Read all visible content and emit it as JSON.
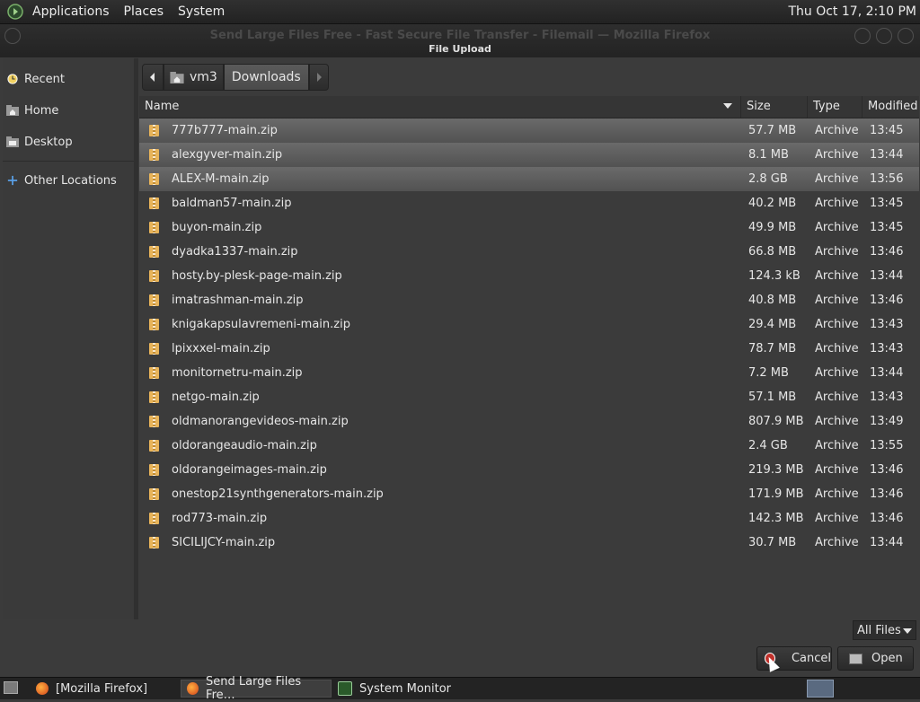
{
  "top_panel": {
    "menus": [
      "Applications",
      "Places",
      "System"
    ],
    "clock": "Thu Oct 17,  2:10 PM"
  },
  "window": {
    "bg_title": "Send Large Files Free - Fast Secure File Transfer - Filemail — Mozilla Firefox",
    "dialog_title": "File Upload"
  },
  "sidebar": {
    "items": [
      {
        "label": "Recent",
        "icon": "clock-icon"
      },
      {
        "label": "Home",
        "icon": "home-folder-icon"
      },
      {
        "label": "Desktop",
        "icon": "desktop-folder-icon"
      },
      {
        "label": "Other Locations",
        "icon": "plus-icon"
      }
    ]
  },
  "pathbar": {
    "crumbs": [
      "vm3",
      "Downloads"
    ]
  },
  "columns": {
    "name": "Name",
    "size": "Size",
    "type": "Type",
    "modified": "Modified"
  },
  "files": [
    {
      "name": "777b777-main.zip",
      "size": "57.7 MB",
      "type": "Archive",
      "modified": "13:45",
      "selected": true
    },
    {
      "name": "alexgyver-main.zip",
      "size": "8.1 MB",
      "type": "Archive",
      "modified": "13:44",
      "selected": true
    },
    {
      "name": "ALEX-M-main.zip",
      "size": "2.8 GB",
      "type": "Archive",
      "modified": "13:56",
      "selected": true
    },
    {
      "name": "baldman57-main.zip",
      "size": "40.2 MB",
      "type": "Archive",
      "modified": "13:45",
      "selected": false
    },
    {
      "name": "buyon-main.zip",
      "size": "49.9 MB",
      "type": "Archive",
      "modified": "13:45",
      "selected": false
    },
    {
      "name": "dyadka1337-main.zip",
      "size": "66.8 MB",
      "type": "Archive",
      "modified": "13:46",
      "selected": false
    },
    {
      "name": "hosty.by-plesk-page-main.zip",
      "size": "124.3 kB",
      "type": "Archive",
      "modified": "13:44",
      "selected": false
    },
    {
      "name": "imatrashman-main.zip",
      "size": "40.8 MB",
      "type": "Archive",
      "modified": "13:46",
      "selected": false
    },
    {
      "name": "knigakapsulavremeni-main.zip",
      "size": "29.4 MB",
      "type": "Archive",
      "modified": "13:43",
      "selected": false
    },
    {
      "name": "lpixxxel-main.zip",
      "size": "78.7 MB",
      "type": "Archive",
      "modified": "13:43",
      "selected": false
    },
    {
      "name": "monitornetru-main.zip",
      "size": "7.2 MB",
      "type": "Archive",
      "modified": "13:44",
      "selected": false
    },
    {
      "name": "netgo-main.zip",
      "size": "57.1 MB",
      "type": "Archive",
      "modified": "13:43",
      "selected": false
    },
    {
      "name": "oldmanorangevideos-main.zip",
      "size": "807.9 MB",
      "type": "Archive",
      "modified": "13:49",
      "selected": false
    },
    {
      "name": "oldorangeaudio-main.zip",
      "size": "2.4 GB",
      "type": "Archive",
      "modified": "13:55",
      "selected": false
    },
    {
      "name": "oldorangeimages-main.zip",
      "size": "219.3 MB",
      "type": "Archive",
      "modified": "13:46",
      "selected": false
    },
    {
      "name": "onestop21synthgenerators-main.zip",
      "size": "171.9 MB",
      "type": "Archive",
      "modified": "13:46",
      "selected": false
    },
    {
      "name": "rod773-main.zip",
      "size": "142.3 MB",
      "type": "Archive",
      "modified": "13:46",
      "selected": false
    },
    {
      "name": "SICILIJCY-main.zip",
      "size": "30.7 MB",
      "type": "Archive",
      "modified": "13:44",
      "selected": false
    }
  ],
  "filter": {
    "label": "All Files"
  },
  "buttons": {
    "cancel": "Cancel",
    "open": "Open"
  },
  "taskbar": {
    "tasks": [
      "[Mozilla Firefox]",
      "Send Large Files Fre…",
      "System Monitor"
    ]
  },
  "colors": {
    "selection": "#5e5e5e",
    "archive_icon": "#e8b45a",
    "cancel_icon": "#c0302a"
  }
}
